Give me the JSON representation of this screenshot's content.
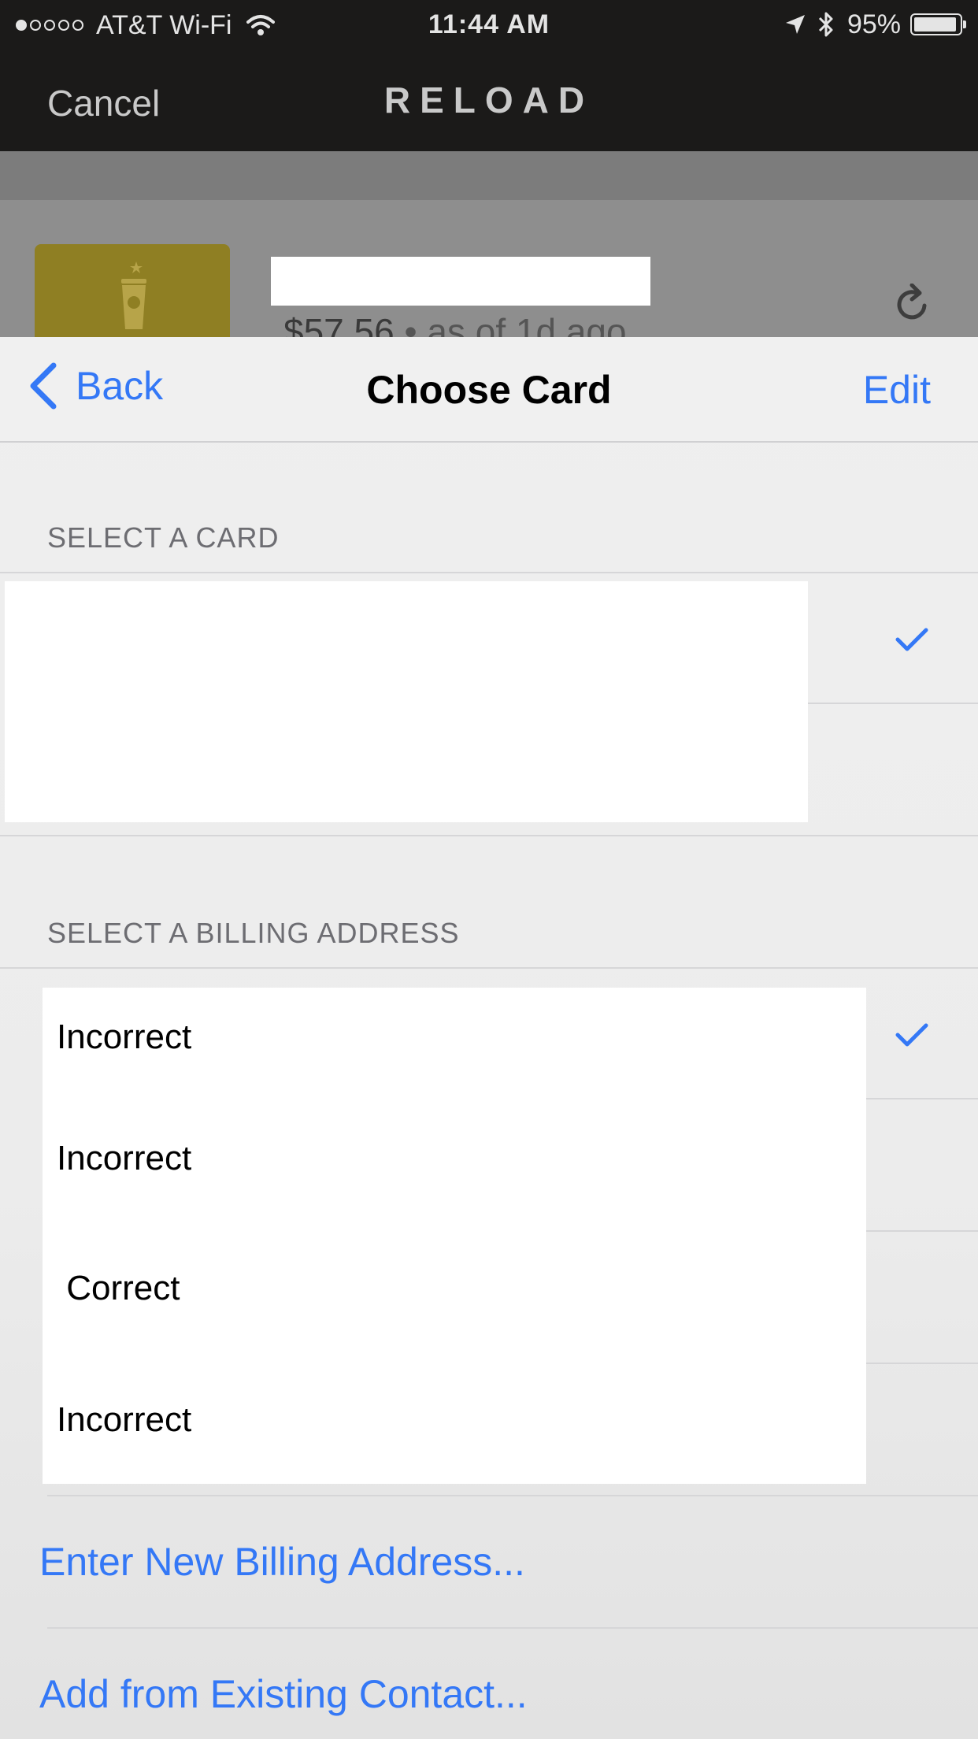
{
  "status_bar": {
    "carrier": "AT&T Wi-Fi",
    "time": "11:44 AM",
    "battery": "95%",
    "battery_level": 0.95,
    "signal_bars_filled": 1,
    "signal_bars_total": 5
  },
  "reload_nav": {
    "cancel_label": "Cancel",
    "title": "RELOAD"
  },
  "card_summary": {
    "balance": "$57.56",
    "balance_age": " • as of 1d ago",
    "card_color": "#8f7f23"
  },
  "sheet": {
    "back_label": "Back",
    "title": "Choose Card",
    "edit_label": "Edit"
  },
  "select_card": {
    "header": "SELECT A CARD"
  },
  "billing": {
    "header": "SELECT A BILLING ADDRESS",
    "addresses": [
      {
        "label": "Incorrect",
        "selected": true
      },
      {
        "label": "Incorrect",
        "selected": false
      },
      {
        "label": " Correct",
        "selected": false
      },
      {
        "label": "Incorrect",
        "selected": false
      }
    ]
  },
  "actions": {
    "enter_new": "Enter New Billing Address...",
    "add_contact": "Add from Existing Contact..."
  },
  "colors": {
    "accent": "#3478f6",
    "dark_bar": "#1b1a19"
  }
}
